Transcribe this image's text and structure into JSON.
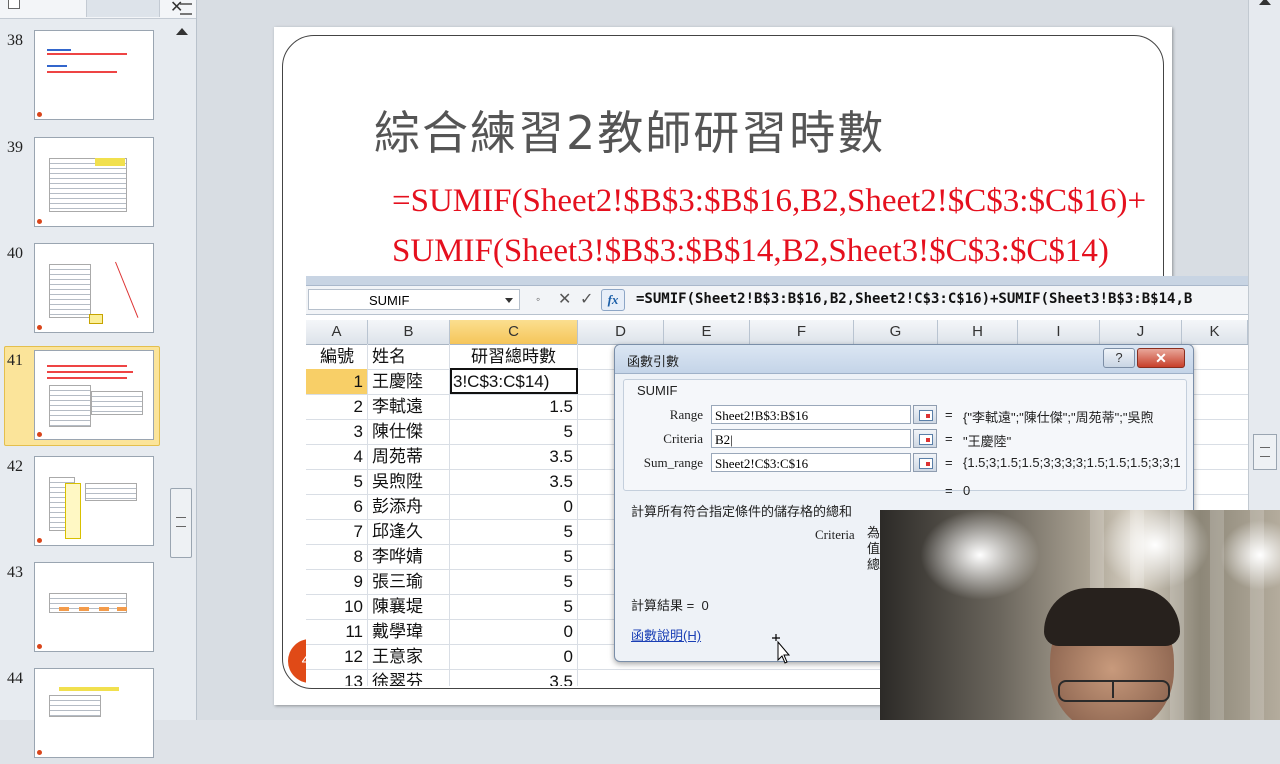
{
  "thumbnails": [
    {
      "num": "38",
      "title": "",
      "selected": false
    },
    {
      "num": "39",
      "title": "",
      "selected": false
    },
    {
      "num": "40",
      "title": "",
      "selected": false
    },
    {
      "num": "41",
      "title": "",
      "selected": true
    },
    {
      "num": "42",
      "title": "",
      "selected": false
    },
    {
      "num": "43",
      "title": "",
      "selected": false
    },
    {
      "num": "44",
      "title": "",
      "selected": false
    }
  ],
  "slide": {
    "title": "綜合練習2教師研習時數",
    "formula_line1": "=SUMIF(Sheet2!$B$3:$B$16,B2,Sheet2!$C$3:$C$16)+",
    "formula_line2": "SUMIF(Sheet3!$B$3:$B$14,B2,Sheet3!$C$3:$C$14)",
    "number": "41"
  },
  "excel": {
    "name_box": "SUMIF",
    "formula_bar": "=SUMIF(Sheet2!B$3:B$16,B2,Sheet2!C$3:C$16)+SUMIF(Sheet3!B$3:B$14,B",
    "columns": [
      "A",
      "B",
      "C",
      "D",
      "E",
      "F",
      "G",
      "H",
      "I",
      "J",
      "K"
    ],
    "header_row": {
      "a": "編號",
      "b": "姓名",
      "c": "研習總時數"
    },
    "rows": [
      {
        "a": "1",
        "b": "王慶陸",
        "c": "3!C$3:C$14)"
      },
      {
        "a": "2",
        "b": "李軾遠",
        "c": "1.5"
      },
      {
        "a": "3",
        "b": "陳仕傑",
        "c": "5"
      },
      {
        "a": "4",
        "b": "周苑蒂",
        "c": "3.5"
      },
      {
        "a": "5",
        "b": "吳煦陞",
        "c": "3.5"
      },
      {
        "a": "6",
        "b": "彭添舟",
        "c": "0"
      },
      {
        "a": "7",
        "b": "邱逢久",
        "c": "5"
      },
      {
        "a": "8",
        "b": "李哗婧",
        "c": "5"
      },
      {
        "a": "9",
        "b": "張三瑜",
        "c": "5"
      },
      {
        "a": "10",
        "b": "陳襄堤",
        "c": "5"
      },
      {
        "a": "11",
        "b": "戴學瑋",
        "c": "0"
      },
      {
        "a": "12",
        "b": "王意家",
        "c": "0"
      },
      {
        "a": "13",
        "b": "徐翠芬",
        "c": "3.5"
      }
    ]
  },
  "dialog": {
    "title": "函數引數",
    "help_button": "?",
    "close_button": "✕",
    "function_name": "SUMIF",
    "args": [
      {
        "label": "Range",
        "value": "Sheet2!B$3:B$16",
        "result": "{\"李軾遠\";\"陳仕傑\";\"周苑蒂\";\"吳煦"
      },
      {
        "label": "Criteria",
        "value": "B2|",
        "result": "\"王慶陸\""
      },
      {
        "label": "Sum_range",
        "value": "Sheet2!C$3:C$16",
        "result": "{1.5;3;1.5;1.5;3;3;3;3;1.5;1.5;1.5;3;3;1"
      }
    ],
    "total_eq": "=",
    "total_value": "0",
    "description": "計算所有符合指定條件的儲存格的總和",
    "criteria_label": "Criteria",
    "criteria_text": "為值總",
    "result_label": "計算結果 =",
    "result_value": "0",
    "help_link": "函數說明(H)"
  }
}
